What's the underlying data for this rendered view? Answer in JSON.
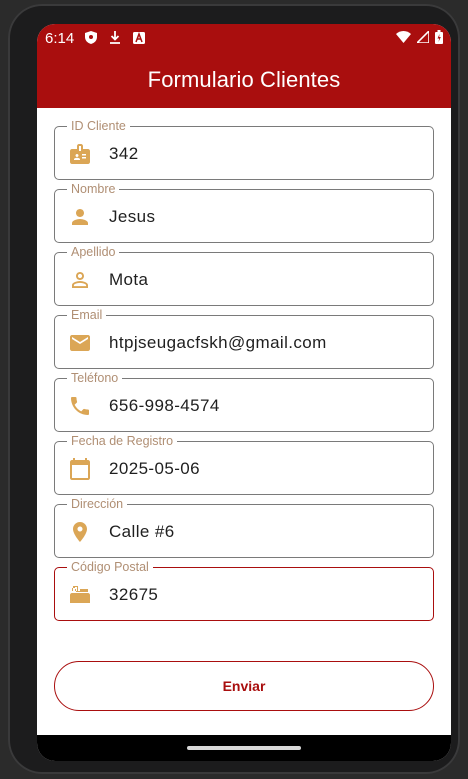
{
  "status_bar": {
    "time": "6:14"
  },
  "app_bar": {
    "title": "Formulario Clientes"
  },
  "form": {
    "fields": [
      {
        "label": "ID Cliente",
        "value": "342",
        "icon": "badge-icon"
      },
      {
        "label": "Nombre",
        "value": "Jesus",
        "icon": "person-icon"
      },
      {
        "label": "Apellido",
        "value": "Mota",
        "icon": "person-outline-icon"
      },
      {
        "label": "Email",
        "value": "htpjseugacfskh@gmail.com",
        "icon": "email-icon"
      },
      {
        "label": "Teléfono",
        "value": "656-998-4574",
        "icon": "phone-icon"
      },
      {
        "label": "Fecha de Registro",
        "value": "2025-05-06",
        "icon": "calendar-icon"
      },
      {
        "label": "Dirección",
        "value": "Calle #6",
        "icon": "location-pin-icon"
      },
      {
        "label": "Código Postal",
        "value": "32675",
        "icon": "mailbox-icon"
      }
    ],
    "submit_label": "Enviar"
  },
  "colors": {
    "primary": "#a90e0e",
    "icon": "#dba656",
    "label": "#b08f74"
  }
}
